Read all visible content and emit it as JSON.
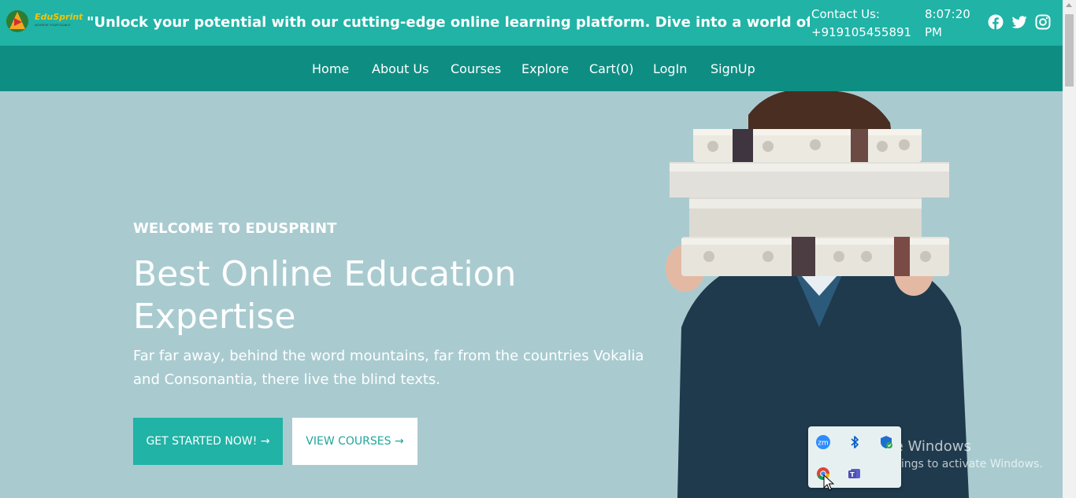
{
  "header": {
    "logo_text": "EduSprint",
    "logo_tagline": "ACHIEVE YOUR GOALS",
    "marquee": "\"Unlock your potential with our cutting-edge online learning platform. Dive into a world of knowledge, personalized",
    "contact_label": "Contact Us:",
    "contact_phone": "+919105455891",
    "time": "8:07:20",
    "ampm": "PM",
    "social": [
      "facebook-icon",
      "twitter-icon",
      "instagram-icon"
    ]
  },
  "nav": {
    "items": [
      "Home",
      "About Us",
      "Courses",
      "Explore",
      "Cart(0)",
      "LogIn",
      "SignUp"
    ]
  },
  "hero": {
    "welcome": "WELCOME TO EDUSPRINT",
    "headline": "Best Online Education Expertise",
    "description": "Far far away, behind the word mountains, far from the countries Vokalia and Consonantia, there live the blind texts.",
    "primary_button": "GET STARTED NOW! →",
    "secondary_button": "VIEW COURSES →"
  },
  "tray": {
    "icons": [
      "zoom-icon",
      "bluetooth-icon",
      "defender-icon",
      "chrome-icon",
      "teams-icon"
    ]
  },
  "watermark": {
    "title": "Activate Windows",
    "subtitle": "Go to Settings to activate Windows."
  },
  "colors": {
    "topbar": "#20b3a6",
    "navbar": "#0e8e83",
    "hero_bg": "#a9cbd0",
    "accent": "#20b3a6"
  }
}
